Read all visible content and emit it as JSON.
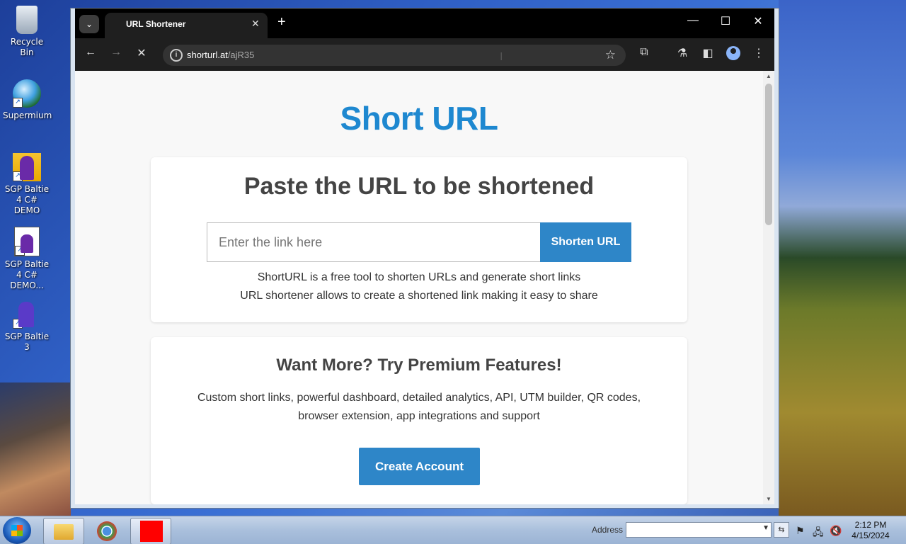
{
  "desktop": {
    "icons": [
      {
        "label": "Recycle Bin",
        "icon": "recycle-bin-icon"
      },
      {
        "label": "Supermium",
        "icon": "supermium-icon"
      },
      {
        "label": "SGP Baltie 4 C# DEMO",
        "icon": "baltie-wizard-icon"
      },
      {
        "label": "SGP Baltie 4 C# DEMO...",
        "icon": "baltie-doc-icon"
      },
      {
        "label": "SGP Baltie 3",
        "icon": "baltie3-wizard-icon"
      }
    ]
  },
  "browser": {
    "tab": {
      "title": "URL Shortener",
      "close": "✕"
    },
    "new_tab": "+",
    "window_controls": {
      "minimize": "—",
      "maximize": "☐",
      "close": "✕"
    },
    "nav": {
      "back": "←",
      "forward": "→",
      "stop": "✕"
    },
    "omnibox": {
      "host": "shorturl.at",
      "path": "/ajR35",
      "info": "i",
      "star": "☆"
    },
    "toolbar_icons": {
      "extensions": "⧉",
      "labs": "⚗",
      "side_panel": "◧",
      "menu": "⋮"
    }
  },
  "page": {
    "title": "Short URL",
    "shorten_card": {
      "heading": "Paste the URL to be shortened",
      "input_placeholder": "Enter the link here",
      "button_label": "Shorten URL",
      "line1": "ShortURL is a free tool to shorten URLs and generate short links",
      "line2": "URL shortener allows to create a shortened link making it easy to share"
    },
    "premium_card": {
      "heading": "Want More? Try Premium Features!",
      "description": "Custom short links, powerful dashboard, detailed analytics, API, UTM builder, QR codes, browser extension, app integrations and support",
      "button_label": "Create Account"
    }
  },
  "taskbar": {
    "address_label": "Address",
    "address_value": "",
    "clock_time": "2:12 PM",
    "clock_date": "4/15/2024"
  }
}
